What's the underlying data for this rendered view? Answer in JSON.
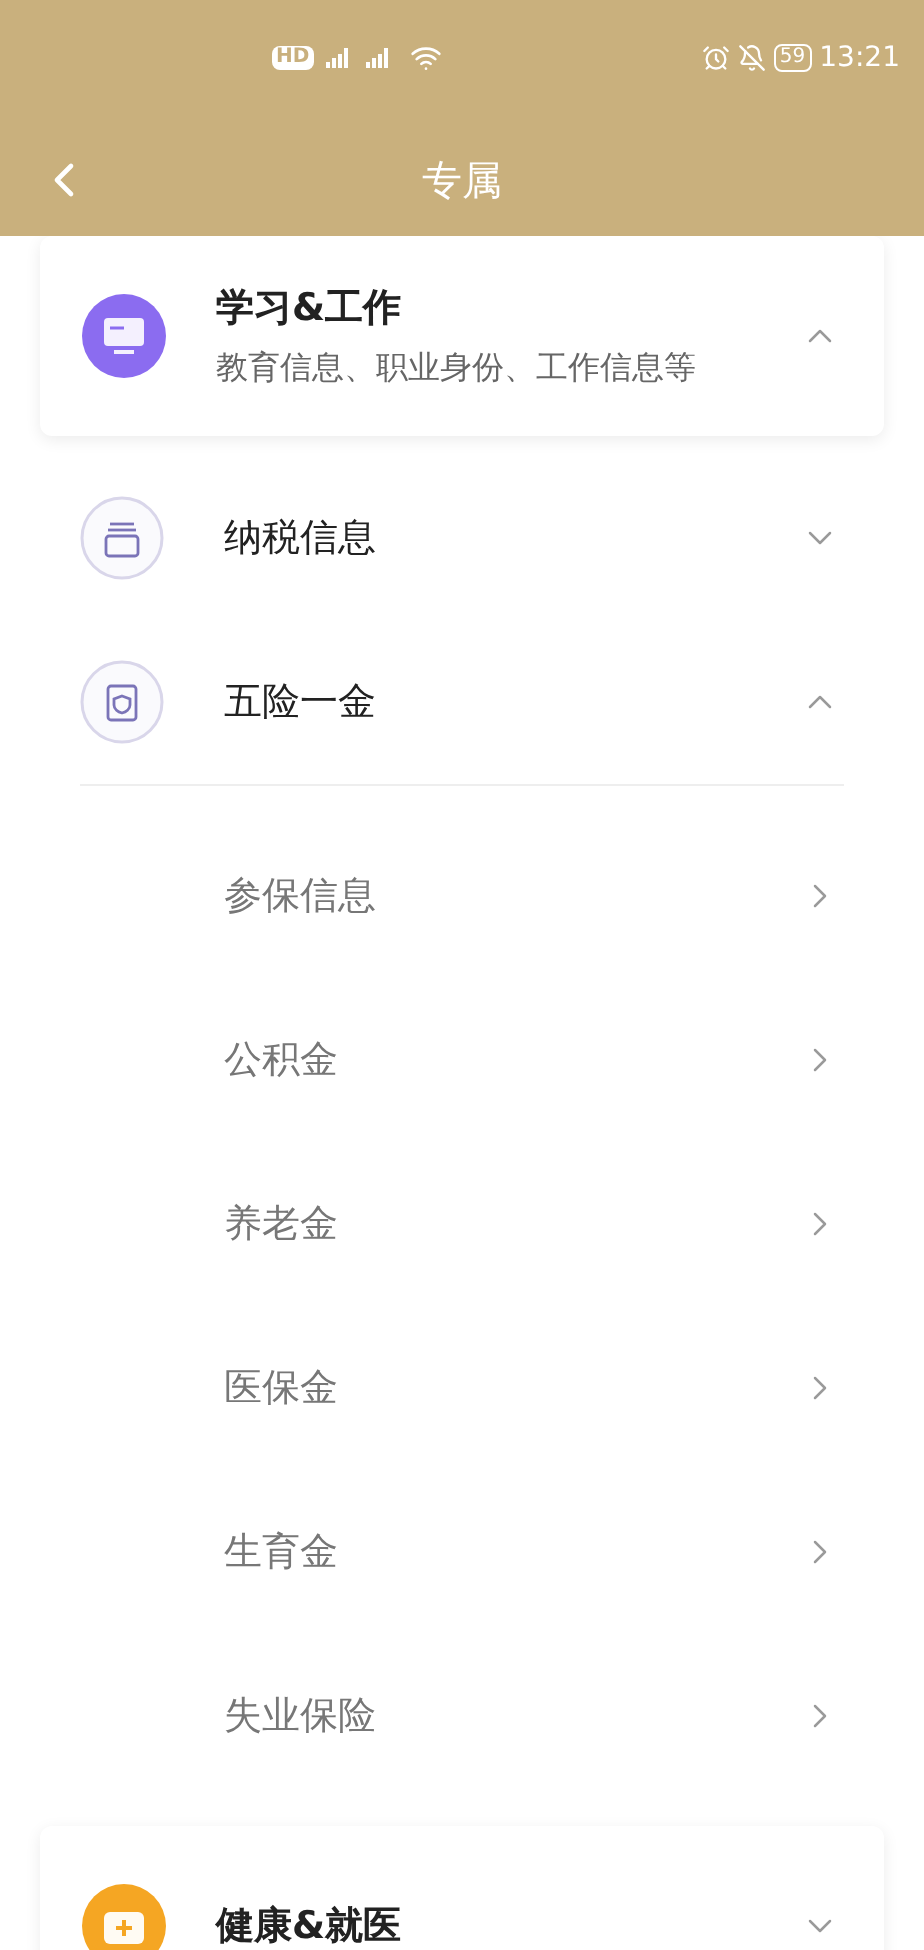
{
  "status_bar": {
    "hd": "HD",
    "battery": "59",
    "time": "13:21"
  },
  "header": {
    "title": "专属"
  },
  "cards": [
    {
      "title": "学习&工作",
      "subtitle": "教育信息、职业身份、工作信息等",
      "color": "#8b6cf0",
      "expanded": true,
      "groups": [
        {
          "title": "纳税信息",
          "expanded": false
        },
        {
          "title": "五险一金",
          "expanded": true,
          "items": [
            "参保信息",
            "公积金",
            "养老金",
            "医保金",
            "生育金",
            "失业保险"
          ]
        }
      ]
    },
    {
      "title": "健康&就医",
      "color": "#f5a623",
      "expanded": false
    }
  ]
}
